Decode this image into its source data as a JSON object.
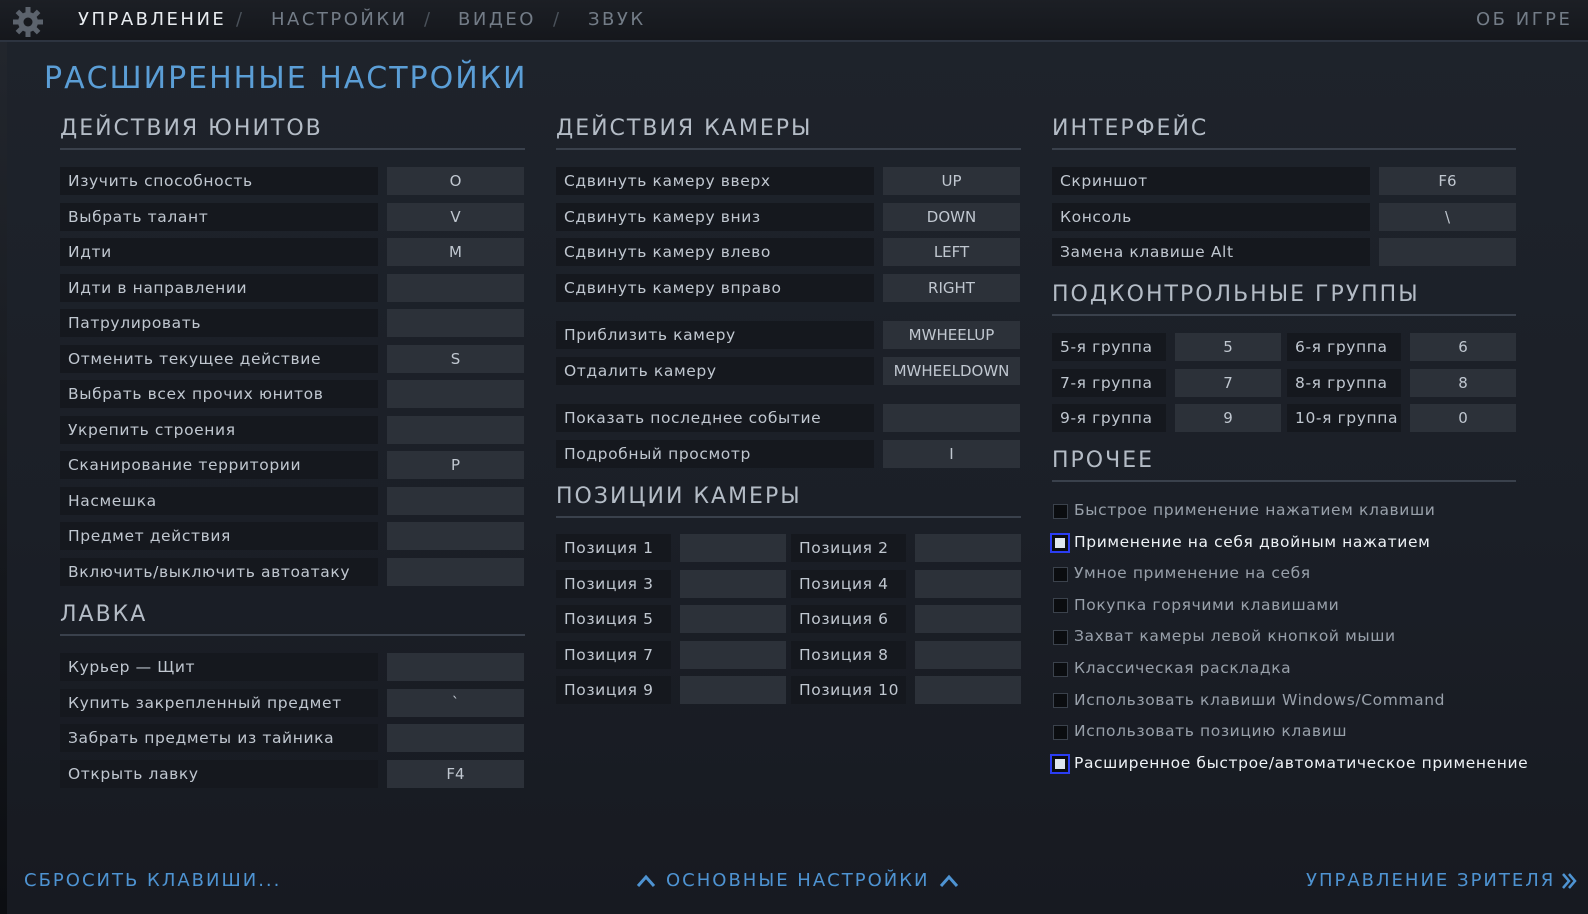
{
  "nav": {
    "tabs": [
      "УПРАВЛЕНИЕ",
      "НАСТРОЙКИ",
      "ВИДЕО",
      "ЗВУК"
    ],
    "separator": "/",
    "about": "ОБ ИГРЕ"
  },
  "page_title": "РАСШИРЕННЫЕ НАСТРОЙКИ",
  "unit_actions": {
    "title": "ДЕЙСТВИЯ ЮНИТОВ",
    "rows": [
      {
        "label": "Изучить способность",
        "key": "O"
      },
      {
        "label": "Выбрать талант",
        "key": "V"
      },
      {
        "label": "Идти",
        "key": "M"
      },
      {
        "label": "Идти в направлении",
        "key": ""
      },
      {
        "label": "Патрулировать",
        "key": ""
      },
      {
        "label": "Отменить текущее действие",
        "key": "S"
      },
      {
        "label": "Выбрать всех прочих юнитов",
        "key": ""
      },
      {
        "label": "Укрепить строения",
        "key": ""
      },
      {
        "label": "Сканирование территории",
        "key": "P"
      },
      {
        "label": "Насмешка",
        "key": ""
      },
      {
        "label": "Предмет действия",
        "key": ""
      },
      {
        "label": "Включить/выключить автоатаку",
        "key": ""
      }
    ]
  },
  "shop": {
    "title": "ЛАВКА",
    "rows": [
      {
        "label": "Курьер — Щит",
        "key": ""
      },
      {
        "label": "Купить закрепленный предмет",
        "key": "`"
      },
      {
        "label": "Забрать предметы из тайника",
        "key": ""
      },
      {
        "label": "Открыть лавку",
        "key": "F4"
      }
    ]
  },
  "camera_actions": {
    "title": "ДЕЙСТВИЯ КАМЕРЫ",
    "rows": [
      {
        "label": "Сдвинуть камеру вверх",
        "key": "UP"
      },
      {
        "label": "Сдвинуть камеру вниз",
        "key": "DOWN"
      },
      {
        "label": "Сдвинуть камеру влево",
        "key": "LEFT"
      },
      {
        "label": "Сдвинуть камеру вправо",
        "key": "RIGHT"
      },
      {
        "label": "Приблизить камеру",
        "key": "MWHEELUP"
      },
      {
        "label": "Отдалить камеру",
        "key": "MWHEELDOWN"
      },
      {
        "label": "Показать последнее событие",
        "key": ""
      },
      {
        "label": "Подробный просмотр",
        "key": "I"
      }
    ]
  },
  "camera_positions": {
    "title": "ПОЗИЦИИ КАМЕРЫ",
    "rows": [
      {
        "label": "Позиция 1",
        "key": ""
      },
      {
        "label": "Позиция 2",
        "key": ""
      },
      {
        "label": "Позиция 3",
        "key": ""
      },
      {
        "label": "Позиция 4",
        "key": ""
      },
      {
        "label": "Позиция 5",
        "key": ""
      },
      {
        "label": "Позиция 6",
        "key": ""
      },
      {
        "label": "Позиция 7",
        "key": ""
      },
      {
        "label": "Позиция 8",
        "key": ""
      },
      {
        "label": "Позиция 9",
        "key": ""
      },
      {
        "label": "Позиция 10",
        "key": ""
      }
    ]
  },
  "interface": {
    "title": "ИНТЕРФЕЙС",
    "rows": [
      {
        "label": "Скриншот",
        "key": "F6"
      },
      {
        "label": "Консоль",
        "key": "\\"
      },
      {
        "label": "Замена клавише Alt",
        "key": ""
      }
    ]
  },
  "control_groups": {
    "title": "ПОДКОНТРОЛЬНЫЕ ГРУППЫ",
    "rows": [
      {
        "label": "5-я группа",
        "key": "5"
      },
      {
        "label": "6-я группа",
        "key": "6"
      },
      {
        "label": "7-я группа",
        "key": "7"
      },
      {
        "label": "8-я группа",
        "key": "8"
      },
      {
        "label": "9-я группа",
        "key": "9"
      },
      {
        "label": "10-я группа",
        "key": "0"
      }
    ]
  },
  "misc": {
    "title": "ПРОЧЕЕ",
    "options": [
      {
        "label": "Быстрое применение нажатием клавиши",
        "checked": false
      },
      {
        "label": "Применение на себя двойным нажатием",
        "checked": true
      },
      {
        "label": "Умное применение на себя",
        "checked": false
      },
      {
        "label": "Покупка горячими клавишами",
        "checked": false
      },
      {
        "label": "Захват камеры левой кнопкой мыши",
        "checked": false
      },
      {
        "label": "Классическая раскладка",
        "checked": false
      },
      {
        "label": "Использовать клавиши Windows/Command",
        "checked": false
      },
      {
        "label": "Использовать позицию клавиш",
        "checked": false
      },
      {
        "label": "Расширенное быстрое/автоматическое применение",
        "checked": true
      }
    ]
  },
  "footer": {
    "reset": "СБРОСИТЬ КЛАВИШИ...",
    "basic": "ОСНОВНЫЕ НАСТРОЙКИ",
    "spectator": "УПРАВЛЕНИЕ ЗРИТЕЛЯ"
  },
  "colors": {
    "accent": "#5b9ed6",
    "checkbox_highlight": "#2b3df2",
    "background": "#1c2028"
  }
}
